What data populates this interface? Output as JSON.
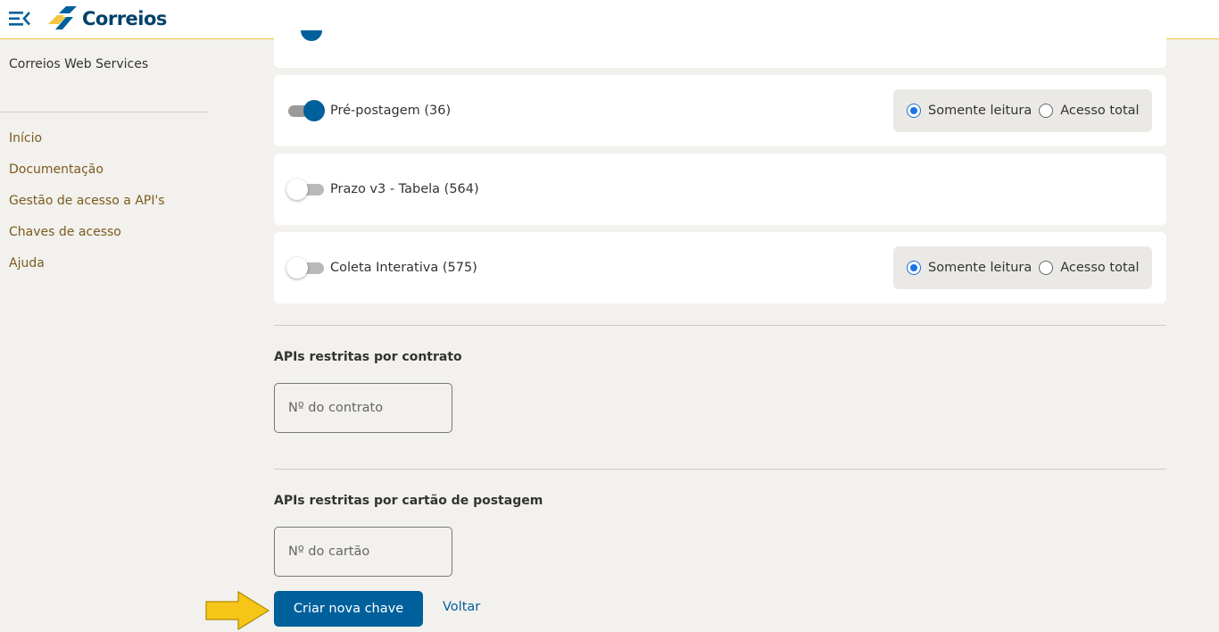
{
  "header": {
    "logo_text": "Correios",
    "menu_icon": "menu-collapse-icon",
    "accent_color": "#f2c641",
    "brand_color": "#00416b"
  },
  "sidebar": {
    "title": "Correios Web Services",
    "items": [
      {
        "label": "Início"
      },
      {
        "label": "Documentação"
      },
      {
        "label": "Gestão de acesso a API's"
      },
      {
        "label": "Chaves de acesso"
      },
      {
        "label": "Ajuda"
      }
    ]
  },
  "apis": [
    {
      "label": "Pré-postagem (36)",
      "enabled": true,
      "show_access": true,
      "access": "Somente leitura"
    },
    {
      "label": "Prazo v3 - Tabela (564)",
      "enabled": false,
      "show_access": false
    },
    {
      "label": "Coleta Interativa (575)",
      "enabled": false,
      "show_access": true,
      "access": "Somente leitura"
    }
  ],
  "access_options": {
    "read_only": "Somente leitura",
    "full": "Acesso total"
  },
  "contract_section": {
    "title": "APIs restritas por contrato",
    "placeholder": "Nº do contrato"
  },
  "card_section": {
    "title": "APIs restritas por cartão de postagem",
    "placeholder": "Nº do cartão"
  },
  "actions": {
    "create_label": "Criar nova chave",
    "back_label": "Voltar"
  },
  "colors": {
    "primary": "#00609c",
    "annotation_arrow": "#f5c518"
  }
}
